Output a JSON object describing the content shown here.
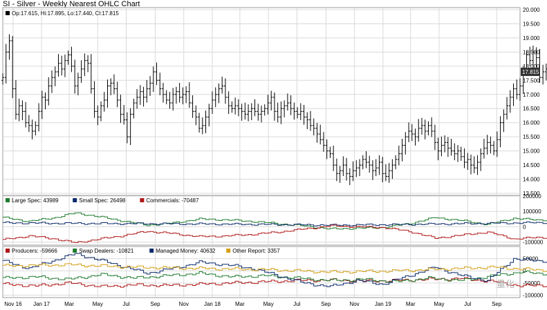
{
  "title": "SI - Silver - Weekly Nearest OHLC Chart",
  "watermark": "量化",
  "colors": {
    "background": "#ffffff",
    "grid": "#d9d9d9",
    "border": "#9a9a9a",
    "price_bar": "#000000",
    "last_price_box": "#333333",
    "large_spec": "#1e7b2e",
    "small_spec": "#0b2a6b",
    "commercials": "#b01818",
    "producers": "#b01818",
    "swap_dealers": "#1e7b2e",
    "managed_money": "#0b2a6b",
    "other_report": "#d4a017"
  },
  "chart_data": [
    {
      "type": "ohlc",
      "title": "SI - Silver - Weekly Nearest OHLC Chart",
      "legend": "Op:17.615, Hi:17.895, Lo:17.440, Cl:17.815",
      "last_price_label": "17.815",
      "ylim": [
        13.5,
        20.0
      ],
      "y_ticks": [
        "20.000",
        "19.500",
        "19.000",
        "18.500",
        "18.000",
        "17.500",
        "17.000",
        "16.500",
        "16.000",
        "15.500",
        "15.000",
        "14.500",
        "14.000",
        "13.500"
      ],
      "y_tick_values": [
        20.0,
        19.5,
        19.0,
        18.5,
        18.0,
        17.5,
        17.0,
        16.5,
        16.0,
        15.5,
        15.0,
        14.5,
        14.0,
        13.5
      ],
      "x_tick_labels": [
        "Nov 16",
        "Jan 17",
        "Mar",
        "May",
        "Jul",
        "Sep",
        "Nov",
        "Jan 18",
        "Mar",
        "May",
        "Jul",
        "Sep",
        "Nov",
        "Jan 19",
        "Mar",
        "May",
        "Jul",
        "Sep"
      ],
      "x_tick_dates": [
        "2016-11-01",
        "2017-01-01",
        "2017-03-01",
        "2017-05-01",
        "2017-07-01",
        "2017-09-01",
        "2017-11-01",
        "2018-01-01",
        "2018-03-01",
        "2018-05-01",
        "2018-07-01",
        "2018-09-01",
        "2018-11-01",
        "2019-01-01",
        "2019-03-01",
        "2019-05-01",
        "2019-07-01",
        "2019-09-01"
      ],
      "x_range_dates": [
        "2016-10-10",
        "2019-10-21"
      ],
      "grid": true,
      "frequency": "weekly",
      "first_week": "2016-10-10",
      "close": [
        17.6,
        18.5,
        18.9,
        17.2,
        16.3,
        16.6,
        16.4,
        16.0,
        15.9,
        15.7,
        15.9,
        16.4,
        16.9,
        16.8,
        17.3,
        17.6,
        17.8,
        18.1,
        17.9,
        18.2,
        18.4,
        18.0,
        17.3,
        17.6,
        17.9,
        18.2,
        18.1,
        17.2,
        16.4,
        16.2,
        16.6,
        16.8,
        17.3,
        17.4,
        17.2,
        16.8,
        16.3,
        16.1,
        15.5,
        16.3,
        16.7,
        16.9,
        17.1,
        16.9,
        17.2,
        17.4,
        17.8,
        17.5,
        17.2,
        17.0,
        16.8,
        16.7,
        17.0,
        17.1,
        16.9,
        17.0,
        17.1,
        16.7,
        16.4,
        16.2,
        15.8,
        15.9,
        16.2,
        16.5,
        16.8,
        17.0,
        17.2,
        17.3,
        16.9,
        16.6,
        16.5,
        16.6,
        16.5,
        16.4,
        16.3,
        16.4,
        16.5,
        16.4,
        16.3,
        16.4,
        16.5,
        16.7,
        16.9,
        16.4,
        16.2,
        16.5,
        16.6,
        16.7,
        16.5,
        16.4,
        16.3,
        16.4,
        16.2,
        16.1,
        15.9,
        15.8,
        15.6,
        15.4,
        15.2,
        15.0,
        14.9,
        14.5,
        14.2,
        14.3,
        14.5,
        14.2,
        14.1,
        14.3,
        14.4,
        14.5,
        14.7,
        14.6,
        14.5,
        14.3,
        14.4,
        14.6,
        14.2,
        14.1,
        14.3,
        14.5,
        14.7,
        14.9,
        15.2,
        15.5,
        15.7,
        15.6,
        15.5,
        15.8,
        15.9,
        15.7,
        15.9,
        15.7,
        15.3,
        15.0,
        15.2,
        15.3,
        15.1,
        15.0,
        14.9,
        15.0,
        14.8,
        14.6,
        14.7,
        14.5,
        14.4,
        14.6,
        14.9,
        15.1,
        15.3,
        15.2,
        15.0,
        15.4,
        16.0,
        16.3,
        16.6,
        16.9,
        17.2,
        17.0,
        17.3,
        17.8,
        18.4,
        18.2,
        18.5,
        18.3,
        17.6,
        17.8,
        17.9,
        17.6,
        17.3,
        17.7,
        17.8
      ],
      "subcharts": [
        {
          "legend": [
            {
              "label": "Large Spec: 43989",
              "color_key": "large_spec"
            },
            {
              "label": "Small Spec: 26498",
              "color_key": "small_spec"
            },
            {
              "label": "Commercials: -70487",
              "color_key": "commercials"
            }
          ],
          "ylim": [
            -120000,
            200000
          ],
          "y_ticks": [
            "200000",
            "100000",
            "0",
            "-100000"
          ],
          "y_tick_values": [
            200000,
            100000,
            0,
            -100000
          ],
          "series": [
            {
              "name": "Large Spec",
              "color_key": "large_spec",
              "anchors_week": [
                0,
                8,
                16,
                22,
                28,
                36,
                44,
                52,
                60,
                68,
                76,
                84,
                92,
                100,
                108,
                116,
                124,
                132,
                140,
                148,
                156,
                163
              ],
              "anchors_value": [
                60000,
                35000,
                60000,
                90000,
                70000,
                40000,
                10000,
                25000,
                50000,
                45000,
                35000,
                20000,
                5000,
                -15000,
                -10000,
                -5000,
                20000,
                60000,
                40000,
                15000,
                55000,
                44000
              ]
            },
            {
              "name": "Small Spec",
              "color_key": "small_spec",
              "anchors_week": [
                0,
                20,
                40,
                60,
                80,
                100,
                120,
                140,
                163
              ],
              "anchors_value": [
                25000,
                22000,
                20000,
                18000,
                15000,
                10000,
                14000,
                20000,
                26500
              ]
            },
            {
              "name": "Commercials",
              "color_key": "commercials",
              "anchors_week": [
                0,
                8,
                16,
                22,
                28,
                36,
                44,
                52,
                60,
                68,
                76,
                84,
                92,
                100,
                108,
                116,
                124,
                132,
                140,
                148,
                156,
                163
              ],
              "anchors_value": [
                -85000,
                -60000,
                -80000,
                -105000,
                -85000,
                -60000,
                -30000,
                -45000,
                -65000,
                -60000,
                -50000,
                -35000,
                -15000,
                5000,
                0,
                -5000,
                -30000,
                -75000,
                -55000,
                -35000,
                -80000,
                -70500
              ]
            }
          ]
        },
        {
          "legend": [
            {
              "label": "Producers: -59666",
              "color_key": "producers"
            },
            {
              "label": "Swap Dealers: -10821",
              "color_key": "swap_dealers"
            },
            {
              "label": "Managed Money: 40632",
              "color_key": "managed_money"
            },
            {
              "label": "Other Report: 3357",
              "color_key": "other_report"
            }
          ],
          "ylim": [
            -110000,
            100000
          ],
          "y_ticks": [
            "50000",
            "0",
            "-50000",
            "-100000"
          ],
          "y_tick_values": [
            50000,
            0,
            -50000,
            -100000
          ],
          "series": [
            {
              "name": "Producers",
              "color_key": "producers",
              "anchors_week": [
                0,
                10,
                20,
                30,
                40,
                50,
                60,
                70,
                80,
                90,
                100,
                110,
                120,
                130,
                140,
                150,
                158,
                163
              ],
              "anchors_value": [
                -55000,
                -62000,
                -50000,
                -65000,
                -58000,
                -60000,
                -55000,
                -50000,
                -45000,
                -40000,
                -38000,
                -42000,
                -40000,
                -35000,
                -32000,
                -45000,
                -62000,
                -59700
              ]
            },
            {
              "name": "Swap Dealers",
              "color_key": "swap_dealers",
              "anchors_week": [
                0,
                10,
                20,
                30,
                40,
                50,
                60,
                70,
                80,
                90,
                100,
                110,
                120,
                130,
                140,
                150,
                158,
                163
              ],
              "anchors_value": [
                -30000,
                -25000,
                -35000,
                -15000,
                -30000,
                -20000,
                -10000,
                -25000,
                -20000,
                -30000,
                -40000,
                -35000,
                -45000,
                -30000,
                -40000,
                -20000,
                -5000,
                -10800
              ]
            },
            {
              "name": "Managed Money",
              "color_key": "managed_money",
              "anchors_week": [
                0,
                8,
                16,
                22,
                28,
                36,
                44,
                52,
                60,
                68,
                76,
                84,
                92,
                100,
                108,
                116,
                124,
                132,
                140,
                148,
                156,
                163
              ],
              "anchors_value": [
                40000,
                10000,
                45000,
                70000,
                50000,
                20000,
                -10000,
                10000,
                35000,
                25000,
                10000,
                -20000,
                -50000,
                -65000,
                -40000,
                -55000,
                -20000,
                15000,
                -20000,
                -40000,
                50000,
                40600
              ]
            },
            {
              "name": "Other Report",
              "color_key": "other_report",
              "anchors_week": [
                0,
                20,
                40,
                60,
                80,
                100,
                120,
                140,
                150,
                163
              ],
              "anchors_value": [
                20000,
                25000,
                15000,
                10000,
                5000,
                -5000,
                0,
                10000,
                15000,
                3400
              ]
            }
          ]
        }
      ]
    }
  ]
}
